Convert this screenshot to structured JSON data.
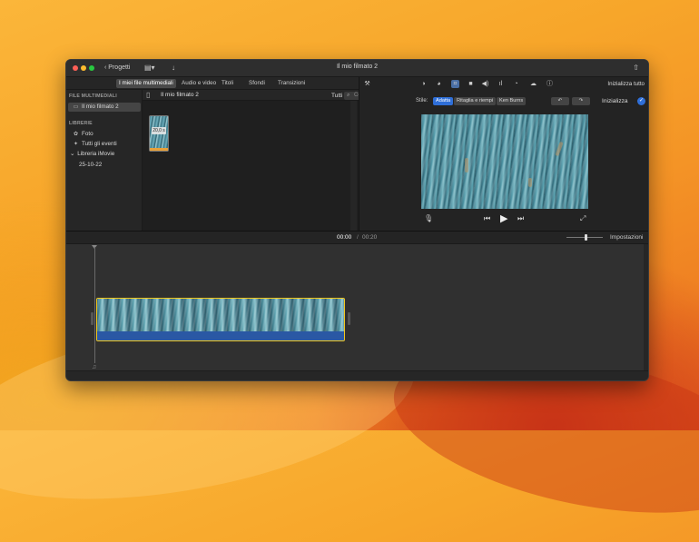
{
  "window": {
    "title": "Il mio filmato 2"
  },
  "toolbar": {
    "back_label": "Progetti",
    "reset_all_label": "Inizializza tutto"
  },
  "browser_tabs": [
    "I miei file multimediali",
    "Audio e video",
    "Titoli",
    "Sfondi",
    "Transizioni"
  ],
  "sidebar": {
    "media_header": "FILE MULTIMEDIALI",
    "project_item": "Il mio filmato 2",
    "libraries_header": "LIBRERIE",
    "items": [
      "Foto",
      "Tutti gli eventi"
    ],
    "library_name": "Libreria iMovie",
    "event": "25-10-22"
  },
  "media": {
    "title": "Il mio filmato 2",
    "filter": "Tutti",
    "search_placeholder": "Cerca",
    "clip_duration": "20,0 s"
  },
  "viewer": {
    "style_label": "Stile:",
    "styles": [
      "Adatta",
      "Ritaglia e riempi",
      "Ken Burns"
    ],
    "selected_style": "Adatta",
    "reset_label": "Inizializza"
  },
  "timeline": {
    "current_time": "00:00",
    "separator": "/",
    "total_time": "00:20",
    "settings_label": "Impostazioni"
  },
  "colors": {
    "accent": "#2f6fd8",
    "clip_border": "#f2c81d",
    "audio": "#2a58a4"
  }
}
